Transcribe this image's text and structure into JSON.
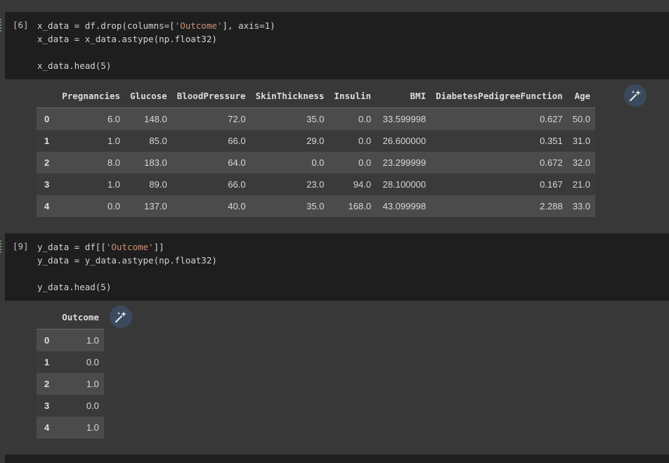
{
  "cells": [
    {
      "exec_count": "[6]",
      "code": [
        [
          {
            "t": "x_data = df.drop(columns=["
          },
          {
            "t": "'Outcome'",
            "s": "str"
          },
          {
            "t": "], axis=1)"
          }
        ],
        [
          {
            "t": "x_data = x_data.astype(np.float32)"
          }
        ],
        [],
        [
          {
            "t": "x_data.head(5)"
          }
        ]
      ]
    },
    {
      "exec_count": "[9]",
      "code": [
        [
          {
            "t": "y_data = df[["
          },
          {
            "t": "'Outcome'",
            "s": "str"
          },
          {
            "t": "]]"
          }
        ],
        [
          {
            "t": "y_data = y_data.astype(np.float32)"
          }
        ],
        [],
        [
          {
            "t": "y_data.head(5)"
          }
        ]
      ]
    }
  ],
  "x_table": {
    "columns": [
      "Pregnancies",
      "Glucose",
      "BloodPressure",
      "SkinThickness",
      "Insulin",
      "BMI",
      "DiabetesPedigreeFunction",
      "Age"
    ],
    "rows": [
      {
        "index": "0",
        "values": [
          "6.0",
          "148.0",
          "72.0",
          "35.0",
          "0.0",
          "33.599998",
          "0.627",
          "50.0"
        ]
      },
      {
        "index": "1",
        "values": [
          "1.0",
          "85.0",
          "66.0",
          "29.0",
          "0.0",
          "26.600000",
          "0.351",
          "31.0"
        ]
      },
      {
        "index": "2",
        "values": [
          "8.0",
          "183.0",
          "64.0",
          "0.0",
          "0.0",
          "23.299999",
          "0.672",
          "32.0"
        ]
      },
      {
        "index": "3",
        "values": [
          "1.0",
          "89.0",
          "66.0",
          "23.0",
          "94.0",
          "28.100000",
          "0.167",
          "21.0"
        ]
      },
      {
        "index": "4",
        "values": [
          "0.0",
          "137.0",
          "40.0",
          "35.0",
          "168.0",
          "43.099998",
          "2.288",
          "33.0"
        ]
      }
    ]
  },
  "y_table": {
    "columns": [
      "Outcome"
    ],
    "rows": [
      {
        "index": "0",
        "values": [
          "1.0"
        ]
      },
      {
        "index": "1",
        "values": [
          "0.0"
        ]
      },
      {
        "index": "2",
        "values": [
          "1.0"
        ]
      },
      {
        "index": "3",
        "values": [
          "0.0"
        ]
      },
      {
        "index": "4",
        "values": [
          "1.0"
        ]
      }
    ]
  },
  "icons": {
    "magic_button": "magic-wand-icon"
  },
  "colors": {
    "string_literal": "#ce9178",
    "cell_bg": "#1e1e1e",
    "page_bg": "#383838",
    "magic_button_bg": "#3b4a5d"
  }
}
